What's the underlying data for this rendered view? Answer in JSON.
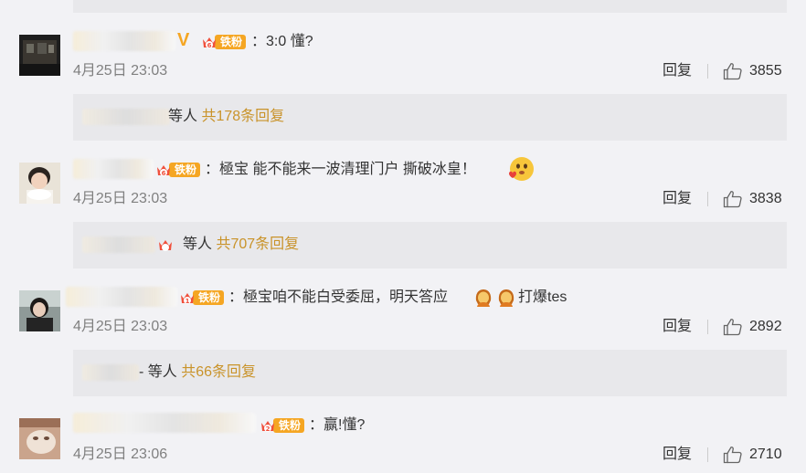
{
  "comments": [
    {
      "text": "：3:0 懂?",
      "time": "4月25日 23:03",
      "reply_label": "回复",
      "likes": "3855",
      "badge": "铁粉",
      "badge_level": "6",
      "vip_mark": "V",
      "replies": {
        "prefix": "等人",
        "count_text": "共178条回复"
      }
    },
    {
      "text": "：極宝 能不能来一波清理门户 撕破冰皇！",
      "time": "4月25日 23:03",
      "reply_label": "回复",
      "likes": "3838",
      "badge": "铁粉",
      "badge_level": "6",
      "replies": {
        "prefix": "等人",
        "count_text": "共707条回复"
      }
    },
    {
      "text": "：極宝咱不能白受委屈，明天答应",
      "text_suffix": "打爆tes",
      "time": "4月25日 23:03",
      "reply_label": "回复",
      "likes": "2892",
      "badge": "铁粉",
      "badge_level": "1",
      "replies": {
        "prefix": "- 等人",
        "count_text": "共66条回复"
      }
    },
    {
      "text": "：赢!懂?",
      "time": "4月25日 23:06",
      "reply_label": "回复",
      "likes": "2710",
      "badge": "铁粉",
      "badge_level": "2"
    }
  ],
  "colors": {
    "background": "#f2f2f5",
    "reply_box": "#e8e8eb",
    "badge": "#f5a623",
    "reply_count": "#c9932a",
    "time": "#808080"
  }
}
